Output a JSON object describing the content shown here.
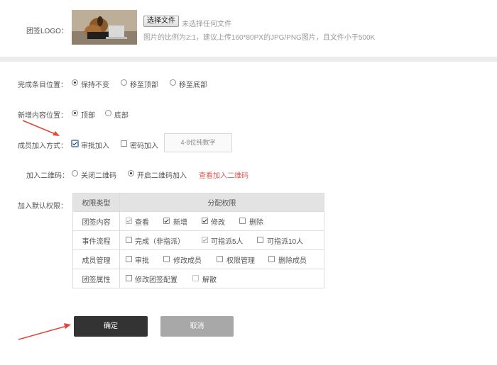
{
  "logo": {
    "label": "团签LOGO：",
    "file_button": "选择文件",
    "file_status": "未选择任何文件",
    "hint": "图片的比例为2:1，建议上传160*80PX的JPG/PNG图片，且文件小于500K"
  },
  "completed_position": {
    "label": "完成条目位置：",
    "options": [
      "保持不变",
      "移至顶部",
      "移至底部"
    ],
    "selected": "保持不变"
  },
  "new_content_position": {
    "label": "新增内容位置：",
    "options": [
      "顶部",
      "底部"
    ],
    "selected": "顶部"
  },
  "join_method": {
    "label": "成员加入方式：",
    "option_review": "审批加入",
    "option_password": "密码加入",
    "password_placeholder": "4-8位纯数字"
  },
  "qr_join": {
    "label": "加入二维码：",
    "options": [
      "关闭二维码",
      "开启二维码加入"
    ],
    "selected": "开启二维码加入",
    "link": "查看加入二维码"
  },
  "default_permissions": {
    "label": "加入默认权限：",
    "header_type": "权限类型",
    "header_assign": "分配权限",
    "rows": [
      {
        "type": "团签内容",
        "items": [
          {
            "label": "查看",
            "checked": true,
            "disabled": true
          },
          {
            "label": "新增",
            "checked": true,
            "disabled": false
          },
          {
            "label": "修改",
            "checked": true,
            "disabled": false
          },
          {
            "label": "删除",
            "checked": false,
            "disabled": false
          }
        ]
      },
      {
        "type": "事件流程",
        "items": [
          {
            "label": "完成（非指派）",
            "checked": false,
            "disabled": false
          },
          {
            "label": "可指派5人",
            "checked": true,
            "disabled": true
          },
          {
            "label": "可指派10人",
            "checked": false,
            "disabled": false
          }
        ]
      },
      {
        "type": "成员管理",
        "items": [
          {
            "label": "审批",
            "checked": false,
            "disabled": false
          },
          {
            "label": "修改成员",
            "checked": false,
            "disabled": false
          },
          {
            "label": "权限管理",
            "checked": false,
            "disabled": false
          },
          {
            "label": "删除成员",
            "checked": false,
            "disabled": false
          }
        ]
      },
      {
        "type": "团签属性",
        "items": [
          {
            "label": "修改团签配置",
            "checked": false,
            "disabled": false
          },
          {
            "label": "解散",
            "checked": false,
            "disabled": true
          }
        ]
      }
    ]
  },
  "actions": {
    "confirm": "确定",
    "cancel": "取消"
  },
  "colors": {
    "link": "#e0584f",
    "arrow": "#e5463c",
    "confirm_bg": "#333333",
    "cancel_bg": "#a8a8a8",
    "header_bg": "#e3e3e3"
  }
}
